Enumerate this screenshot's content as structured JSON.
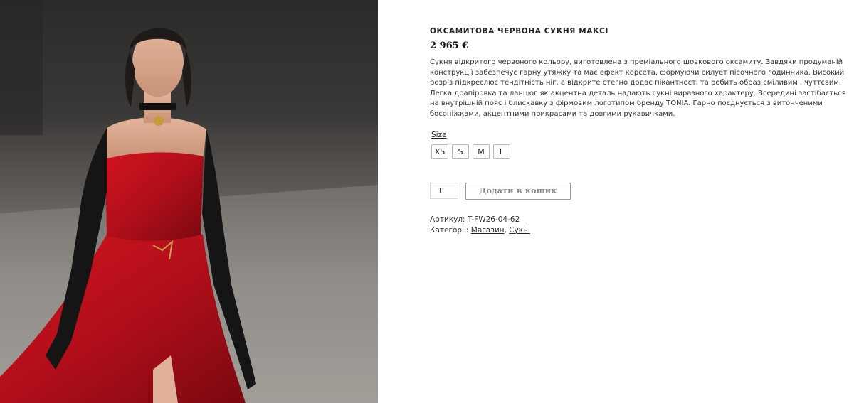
{
  "product": {
    "title": "ОКСАМИТОВА ЧЕРВОНА СУКНЯ МАКСІ",
    "price": "2 965 €",
    "description": "Сукня відкритого червоного кольору, виготовлена з преміального шовкового оксамиту. Завдяки продуманій конструкції забезпечує гарну утяжку та має ефект корсета, формуючи силует пісочного годинника. Високий розріз підкреслює тендітність ніг, а відкрите стегно додає пікантності та робить образ сміливим і чуттєвим. Легка драпіровка та ланцюг як акцентна деталь надають сукні виразного характеру. Всередині застібається на внутрішній пояс і блискавку з фірмовим логотипом бренду TONIA. Гарно поєднується з витонченими босоніжками, акцентними прикрасами та довгими рукавичками."
  },
  "size": {
    "label": "Size",
    "options": [
      "XS",
      "S",
      "M",
      "L"
    ]
  },
  "cart": {
    "quantity": "1",
    "add_label": "Додати в кошик"
  },
  "meta": {
    "sku_label": "Артикул:",
    "sku_value": "T-FW26-04-62",
    "categories_label": "Категорії:",
    "categories": [
      "Магазин",
      "Сукні"
    ],
    "separator": ","
  },
  "colors": {
    "dress": "#b5111c",
    "glove": "#151515",
    "background_photo": "#6d6a66"
  }
}
